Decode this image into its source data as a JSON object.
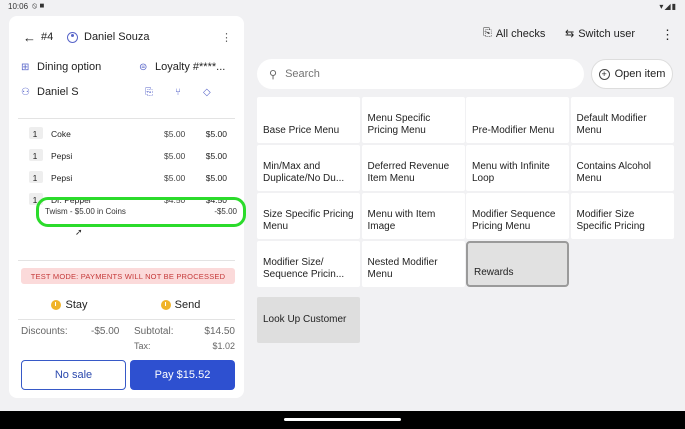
{
  "status_bar": {
    "time": "10:06",
    "left_icons": "⦸ ■",
    "right_icons": "▾◢▮"
  },
  "check": {
    "number": "#4",
    "server": "Daniel Souza",
    "dining_option": "Dining option",
    "loyalty": "Loyalty #****...",
    "customer": "Daniel S",
    "items": [
      {
        "qty": "1",
        "name": "Coke",
        "price": "$5.00",
        "total": "$5.00"
      },
      {
        "qty": "1",
        "name": "Pepsi",
        "price": "$5.00",
        "total": "$5.00"
      },
      {
        "qty": "1",
        "name": "Pepsi",
        "price": "$5.00",
        "total": "$5.00"
      },
      {
        "qty": "1",
        "name": "Dr. Pepper",
        "price": "$4.50",
        "total": "$4.50"
      }
    ],
    "modifier": {
      "name": "Twism - $5.00 in Coins",
      "total": "-$5.00"
    },
    "test_mode": "TEST MODE:  PAYMENTS WILL NOT BE PROCESSED",
    "stay_label": "Stay",
    "send_label": "Send",
    "discounts_label": "Discounts:",
    "discounts_value": "-$5.00",
    "subtotal_label": "Subtotal:",
    "subtotal_value": "$14.50",
    "tax_label": "Tax:",
    "tax_value": "$1.02",
    "no_sale_label": "No sale",
    "pay_label": "Pay $15.52"
  },
  "toolbar": {
    "all_checks": "All checks",
    "switch_user": "Switch user"
  },
  "search": {
    "placeholder": "Search"
  },
  "open_item": "Open item",
  "menu_tiles": [
    "Base Price Menu",
    "Menu Specific Pricing Menu",
    "Pre-Modifier Menu",
    "Default Modifier Menu",
    "Min/Max and Duplicate/No Du...",
    "Deferred Revenue Item Menu",
    "Menu with Infinite Loop",
    "Contains Alcohol Menu",
    "Size Specific Pricing Menu",
    "Menu with Item Image",
    "Modifier Sequence Pricing Menu",
    "Modifier Size Specific Pricing",
    "Modifier Size/ Sequence Pricin...",
    "Nested Modifier Menu",
    "Rewards"
  ],
  "lookup_customer": "Look Up Customer",
  "colors": {
    "primary": "#2e50d0",
    "highlight": "#2bdb2b",
    "test_mode_bg": "#fbdada",
    "test_mode_text": "#c53a3a"
  }
}
